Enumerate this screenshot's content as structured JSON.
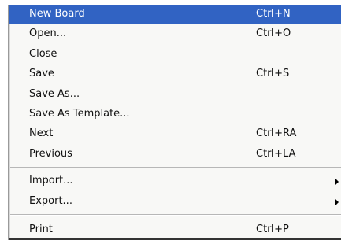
{
  "menu": {
    "items": [
      {
        "label": "New Board",
        "shortcut": "Ctrl+N"
      },
      {
        "label": "Open...",
        "shortcut": "Ctrl+O"
      },
      {
        "label": "Close",
        "shortcut": ""
      },
      {
        "label": "Save",
        "shortcut": "Ctrl+S"
      },
      {
        "label": "Save As...",
        "shortcut": ""
      },
      {
        "label": "Save As Template...",
        "shortcut": ""
      },
      {
        "label": "Next",
        "shortcut": "Ctrl+RA"
      },
      {
        "label": "Previous",
        "shortcut": "Ctrl+LA"
      },
      {
        "label": "Import...",
        "shortcut": ""
      },
      {
        "label": "Export...",
        "shortcut": ""
      },
      {
        "label": "Print",
        "shortcut": "Ctrl+P"
      }
    ],
    "highlight_color": "#3163c3"
  }
}
